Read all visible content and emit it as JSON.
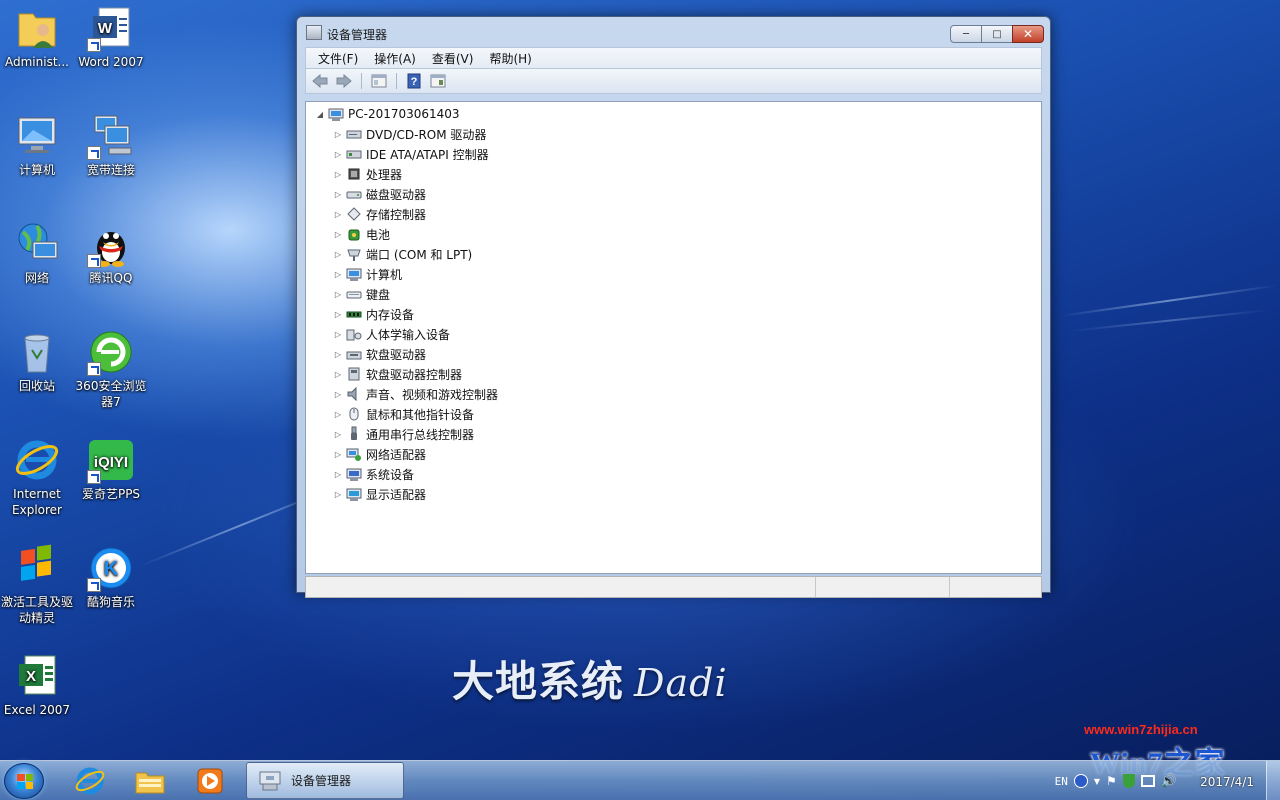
{
  "desktop": {
    "icons": [
      {
        "label": "Administ...",
        "icon": "user-folder-icon"
      },
      {
        "label": "Word 2007",
        "icon": "word-icon"
      },
      {
        "label": "计算机",
        "icon": "computer-icon"
      },
      {
        "label": "宽带连接",
        "icon": "broadband-icon"
      },
      {
        "label": "网络",
        "icon": "network-icon"
      },
      {
        "label": "腾讯QQ",
        "icon": "qq-icon"
      },
      {
        "label": "回收站",
        "icon": "recycle-bin-icon"
      },
      {
        "label": "360安全浏览器7",
        "icon": "browser-360-icon"
      },
      {
        "label": "Internet Explorer",
        "icon": "ie-icon"
      },
      {
        "label": "爱奇艺PPS",
        "icon": "iqiyi-icon"
      },
      {
        "label": "激活工具及驱动精灵",
        "icon": "activation-tool-icon"
      },
      {
        "label": "酷狗音乐",
        "icon": "kugou-icon"
      },
      {
        "label": "Excel 2007",
        "icon": "excel-icon"
      }
    ],
    "brand": "大地系统",
    "brand_latin": "Dadi",
    "watermark_url": "www.win7zhijia.cn",
    "watermark_logo": "Win7之家"
  },
  "window": {
    "title": "设备管理器",
    "menu": [
      "文件(F)",
      "操作(A)",
      "查看(V)",
      "帮助(H)"
    ],
    "toolbar": [
      "back-icon",
      "forward-icon",
      "properties-icon",
      "help-icon",
      "show-hidden-icon"
    ],
    "tree": {
      "root": "PC-201703061403",
      "items": [
        {
          "label": "DVD/CD-ROM 驱动器",
          "icon": "dvd-drive-icon"
        },
        {
          "label": "IDE ATA/ATAPI 控制器",
          "icon": "ide-controller-icon"
        },
        {
          "label": "处理器",
          "icon": "processor-icon"
        },
        {
          "label": "磁盘驱动器",
          "icon": "disk-drive-icon"
        },
        {
          "label": "存储控制器",
          "icon": "storage-controller-icon"
        },
        {
          "label": "电池",
          "icon": "battery-icon"
        },
        {
          "label": "端口 (COM 和 LPT)",
          "icon": "port-icon"
        },
        {
          "label": "计算机",
          "icon": "computer-icon"
        },
        {
          "label": "键盘",
          "icon": "keyboard-icon"
        },
        {
          "label": "内存设备",
          "icon": "memory-icon"
        },
        {
          "label": "人体学输入设备",
          "icon": "hid-icon"
        },
        {
          "label": "软盘驱动器",
          "icon": "floppy-drive-icon"
        },
        {
          "label": "软盘驱动器控制器",
          "icon": "floppy-controller-icon"
        },
        {
          "label": "声音、视频和游戏控制器",
          "icon": "sound-icon"
        },
        {
          "label": "鼠标和其他指针设备",
          "icon": "mouse-icon"
        },
        {
          "label": "通用串行总线控制器",
          "icon": "usb-icon"
        },
        {
          "label": "网络适配器",
          "icon": "network-adapter-icon"
        },
        {
          "label": "系统设备",
          "icon": "system-device-icon"
        },
        {
          "label": "显示适配器",
          "icon": "display-adapter-icon"
        }
      ]
    }
  },
  "taskbar": {
    "pinned": [
      "ie-icon",
      "explorer-icon",
      "media-player-icon"
    ],
    "active_task": "设备管理器",
    "tray": {
      "language": "EN"
    },
    "clock": {
      "time": "",
      "date": "2017/4/1"
    }
  }
}
